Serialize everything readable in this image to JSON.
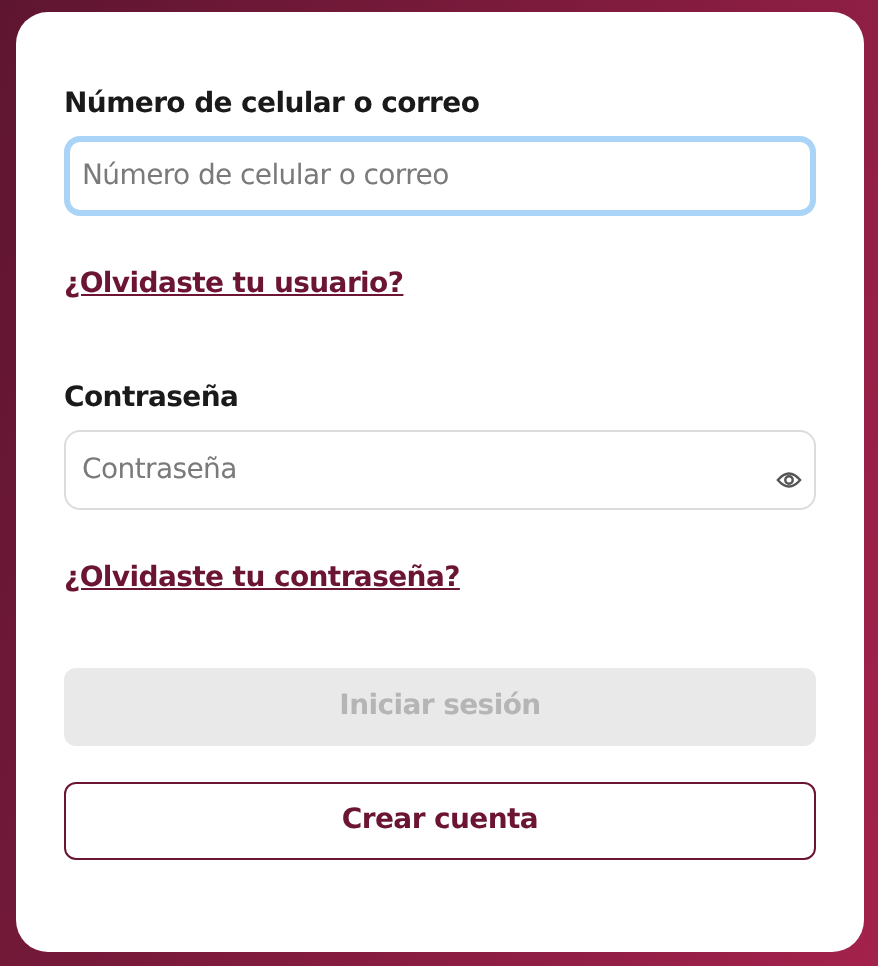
{
  "fields": [
    {
      "label": "Número de celular o correo",
      "placeholder": "Número de celular o correo",
      "focused": true,
      "kind": "text",
      "link": "¿Olvidaste tu usuario?"
    },
    {
      "label": "Contraseña",
      "placeholder": "Contraseña",
      "focused": false,
      "kind": "password",
      "link": "¿Olvidaste tu contraseña?"
    }
  ],
  "buttons": [
    {
      "label": "Iniciar sesión",
      "kind": "primary",
      "disabled": true
    },
    {
      "label": "Crear cuenta",
      "kind": "outline",
      "disabled": false
    }
  ]
}
